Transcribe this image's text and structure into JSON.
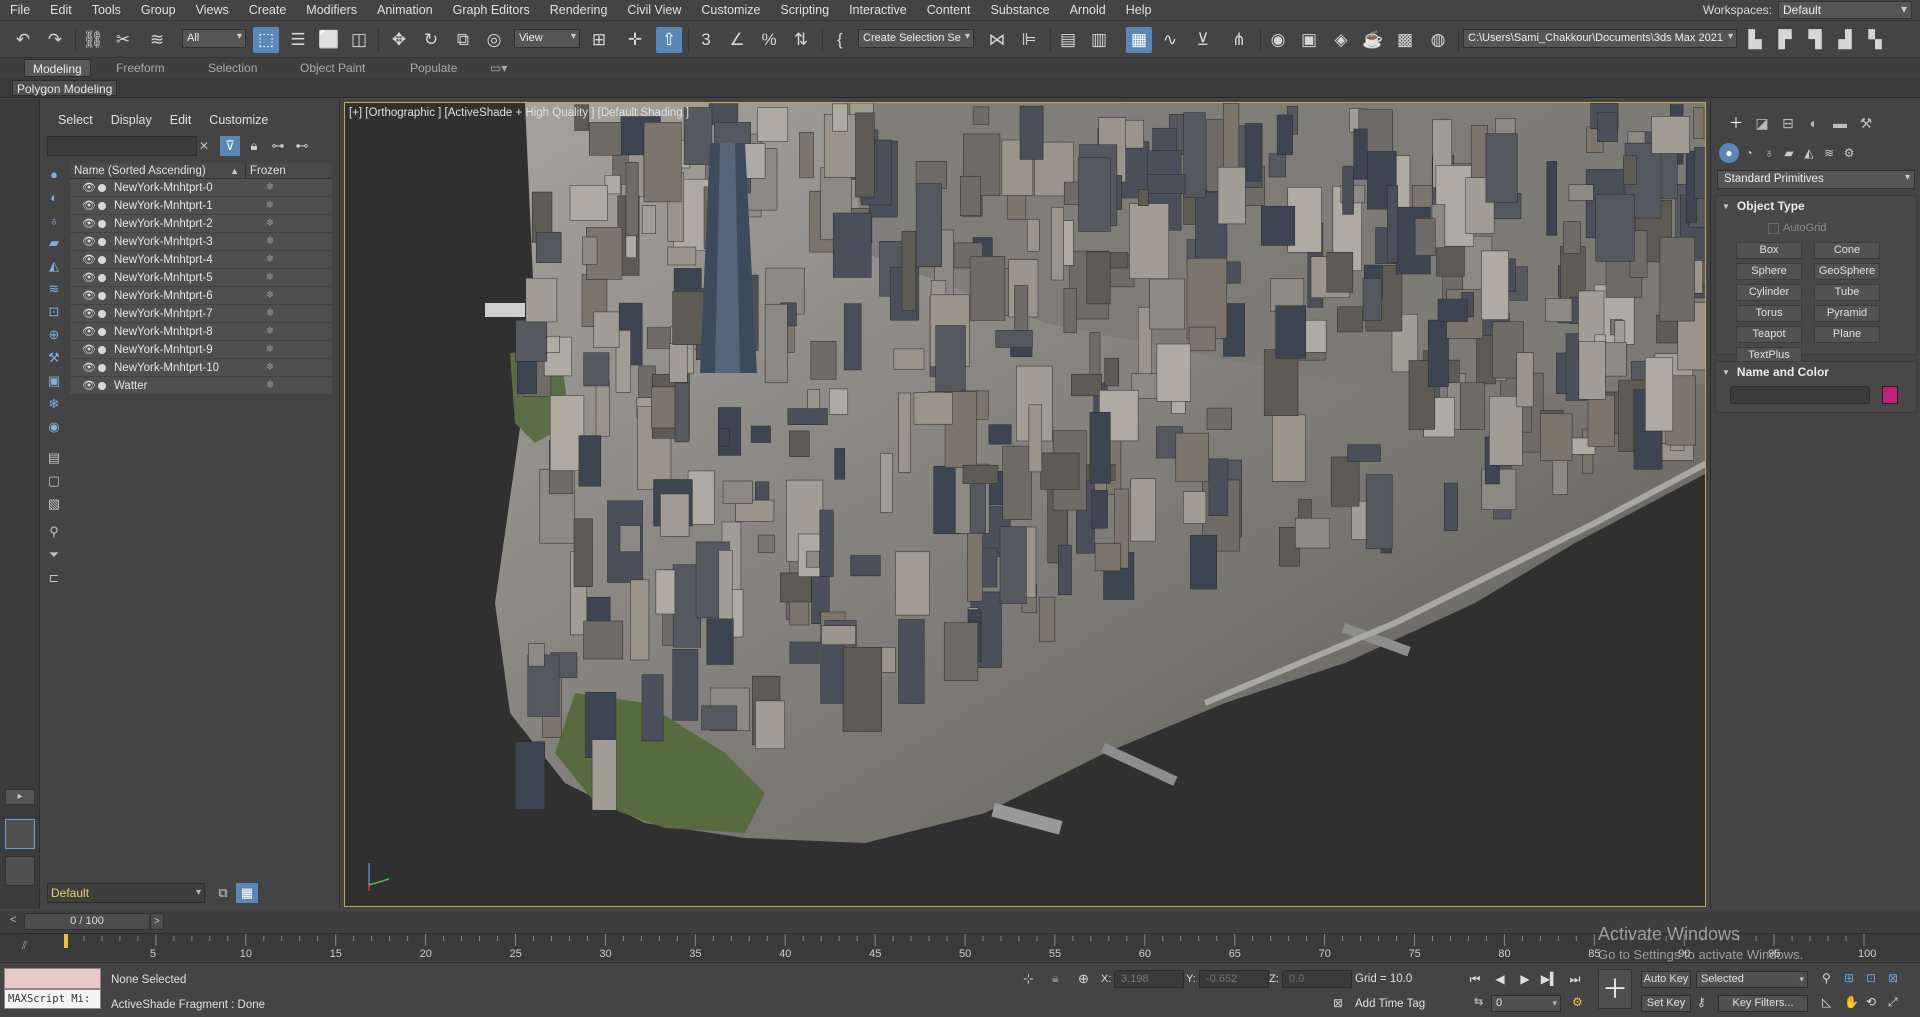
{
  "menu": [
    "File",
    "Edit",
    "Tools",
    "Group",
    "Views",
    "Create",
    "Modifiers",
    "Animation",
    "Graph Editors",
    "Rendering",
    "Civil View",
    "Customize",
    "Scripting",
    "Interactive",
    "Content",
    "Substance",
    "Arnold",
    "Help"
  ],
  "workspace": {
    "label": "Workspaces:",
    "value": "Default"
  },
  "toolbar": {
    "filter_value": "All",
    "view_value": "View",
    "selection_set_placeholder": "Create Selection Se",
    "project_path": "C:\\Users\\Sami_Chakkour\\Documents\\3ds Max 2021"
  },
  "ribbon": {
    "tabs": [
      "Modeling",
      "Freeform",
      "Selection",
      "Object Paint",
      "Populate"
    ],
    "active_tab": "Modeling",
    "sub_label": "Polygon Modeling"
  },
  "explorer": {
    "menu": [
      "Select",
      "Display",
      "Edit",
      "Customize"
    ],
    "column_name": "Name (Sorted Ascending)",
    "column_frozen": "Frozen",
    "rows": [
      "NewYork-Mnhtprt-0",
      "NewYork-Mnhtprt-1",
      "NewYork-Mnhtprt-2",
      "NewYork-Mnhtprt-3",
      "NewYork-Mnhtprt-4",
      "NewYork-Mnhtprt-5",
      "NewYork-Mnhtprt-6",
      "NewYork-Mnhtprt-7",
      "NewYork-Mnhtprt-8",
      "NewYork-Mnhtprt-9",
      "NewYork-Mnhtprt-10",
      "Watter"
    ],
    "layer_value": "Default"
  },
  "viewport": {
    "label": "[+] [Orthographic ] [ActiveShade + High Quality ] [Default Shading ]"
  },
  "command_panel": {
    "category_value": "Standard Primitives",
    "object_type_title": "Object Type",
    "autogrid_label": "AutoGrid",
    "primitives": [
      "Box",
      "Cone",
      "Sphere",
      "GeoSphere",
      "Cylinder",
      "Tube",
      "Torus",
      "Pyramid",
      "Teapot",
      "Plane",
      "TextPlus"
    ],
    "name_color_title": "Name and Color",
    "swatch_color": "#c21f7a"
  },
  "timeline": {
    "frame_display": "0 / 100",
    "ticks": [
      "5",
      "10",
      "15",
      "20",
      "25",
      "30",
      "35",
      "40",
      "45",
      "50",
      "55",
      "60",
      "65",
      "70",
      "75",
      "80",
      "85",
      "90",
      "95",
      "100"
    ]
  },
  "status": {
    "maxscript_label": "MAXScript Mi:",
    "selection_text": "None Selected",
    "prompt_text": "ActiveShade Fragment : Done",
    "x_label": "X:",
    "x_value": "3.198",
    "y_label": "Y:",
    "y_value": "-0.652",
    "z_label": "Z:",
    "z_value": "0.0",
    "grid_text": "Grid = 10.0",
    "add_time_tag": "Add Time Tag",
    "auto_key": "Auto Key",
    "selected_value": "Selected",
    "set_key": "Set Key",
    "key_filters": "Key Filters...",
    "frame_value": "0"
  },
  "watermark": {
    "title": "Activate Windows",
    "subtitle": "Go to Settings to activate Windows."
  }
}
